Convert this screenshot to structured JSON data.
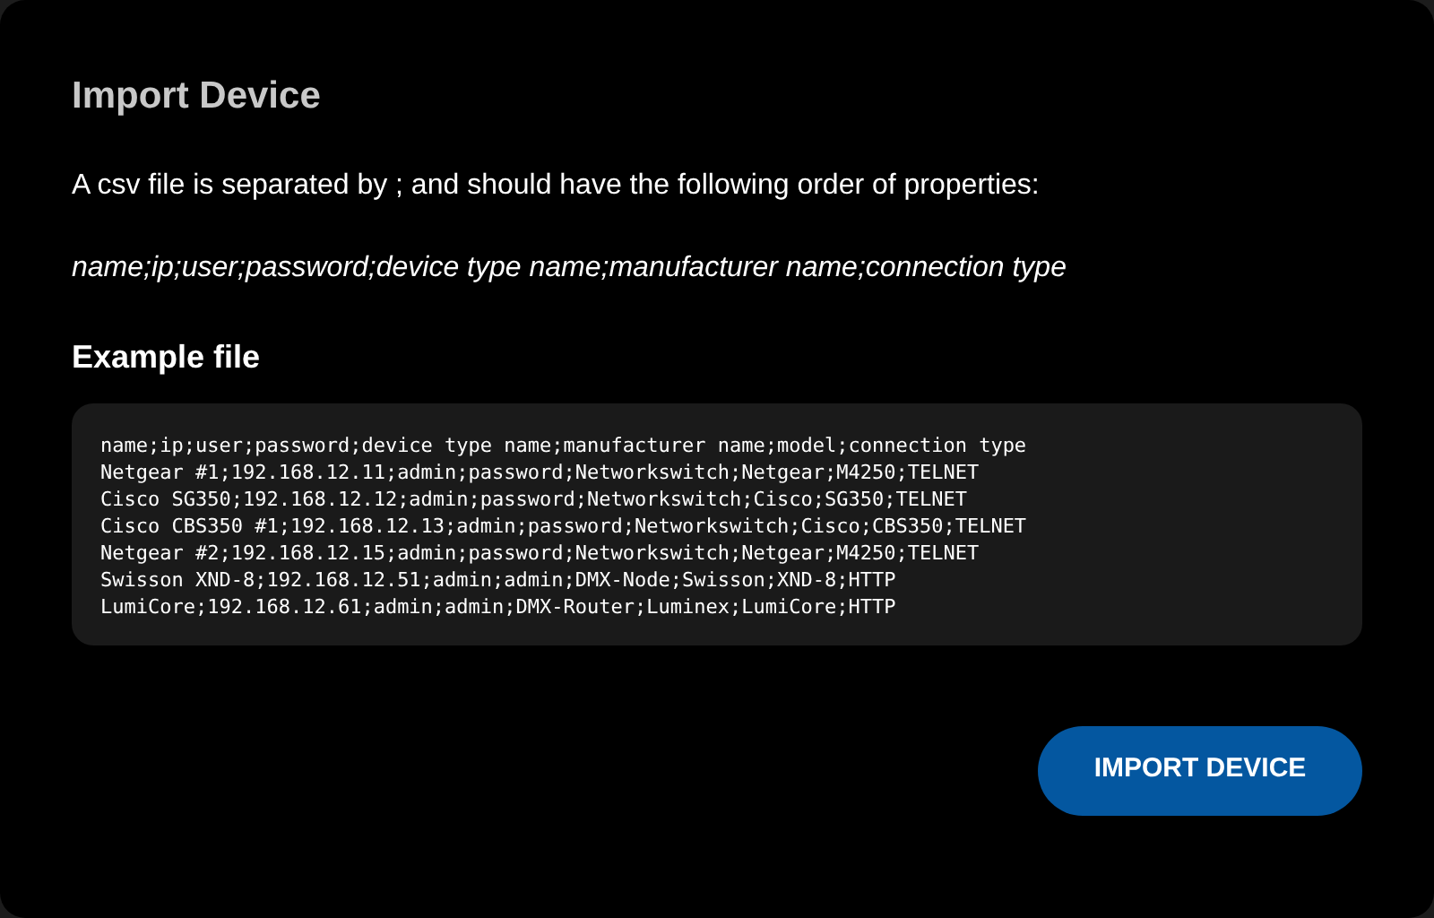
{
  "dialog": {
    "title": "Import Device",
    "description": "A csv file is separated by ; and should have the following order of properties:",
    "format": "name;ip;user;password;device type name;manufacturer name;connection type",
    "example_heading": "Example file",
    "example_lines": [
      "name;ip;user;password;device type name;manufacturer name;model;connection type",
      "Netgear #1;192.168.12.11;admin;password;Networkswitch;Netgear;M4250;TELNET",
      "Cisco SG350;192.168.12.12;admin;password;Networkswitch;Cisco;SG350;TELNET",
      "Cisco CBS350 #1;192.168.12.13;admin;password;Networkswitch;Cisco;CBS350;TELNET",
      "Netgear #2;192.168.12.15;admin;password;Networkswitch;Netgear;M4250;TELNET",
      "Swisson XND-8;192.168.12.51;admin;admin;DMX-Node;Swisson;XND-8;HTTP",
      "LumiCore;192.168.12.61;admin;admin;DMX-Router;Luminex;LumiCore;HTTP"
    ],
    "button": "IMPORT DEVICE"
  }
}
